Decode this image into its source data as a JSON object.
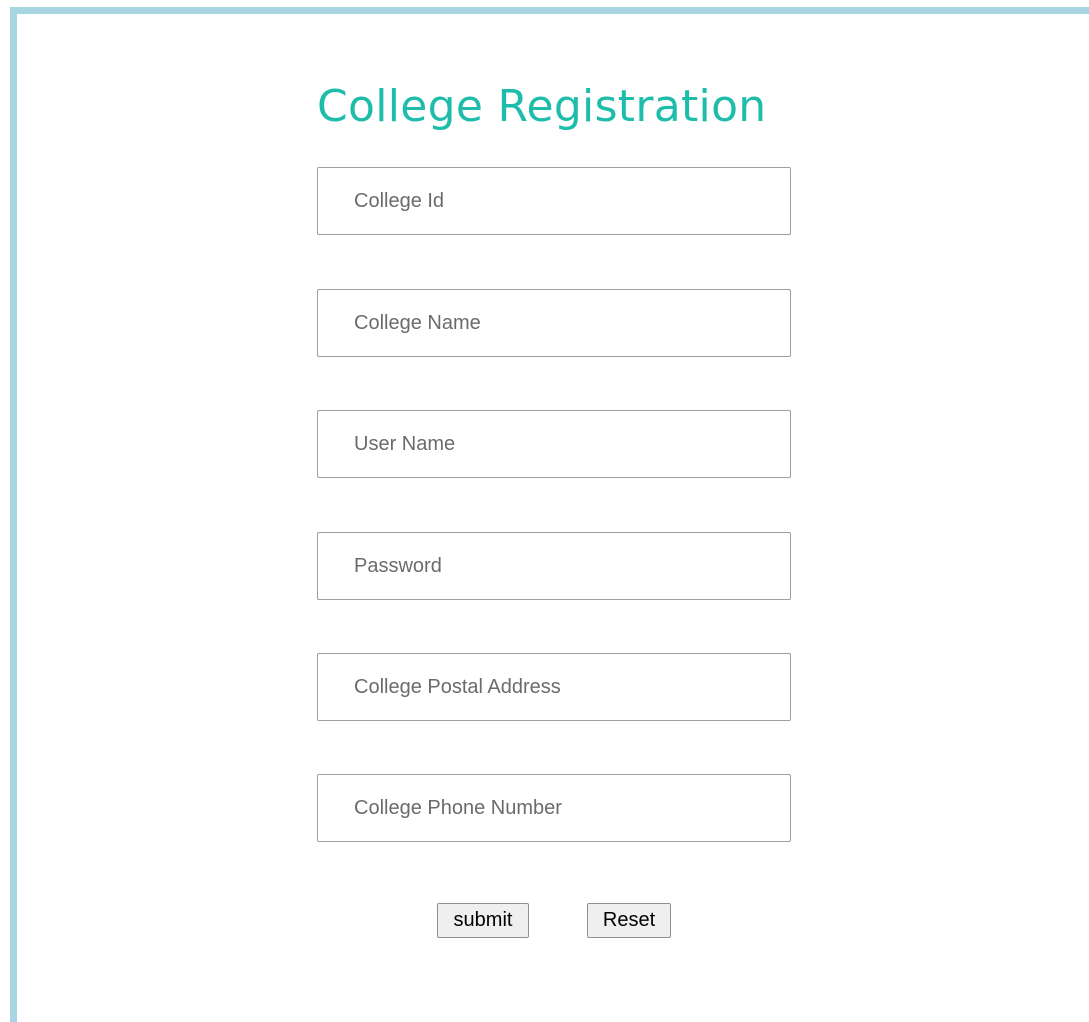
{
  "page": {
    "title": "College Registration",
    "title_color": "#1ebdab",
    "frame_color": "#a8d5e2"
  },
  "form": {
    "fields": [
      {
        "placeholder": "College Id",
        "value": ""
      },
      {
        "placeholder": "College Name",
        "value": ""
      },
      {
        "placeholder": "User Name",
        "value": ""
      },
      {
        "placeholder": "Password",
        "value": ""
      },
      {
        "placeholder": "College Postal Address",
        "value": ""
      },
      {
        "placeholder": "College Phone Number",
        "value": ""
      }
    ],
    "submit_label": "submit",
    "reset_label": "Reset"
  }
}
